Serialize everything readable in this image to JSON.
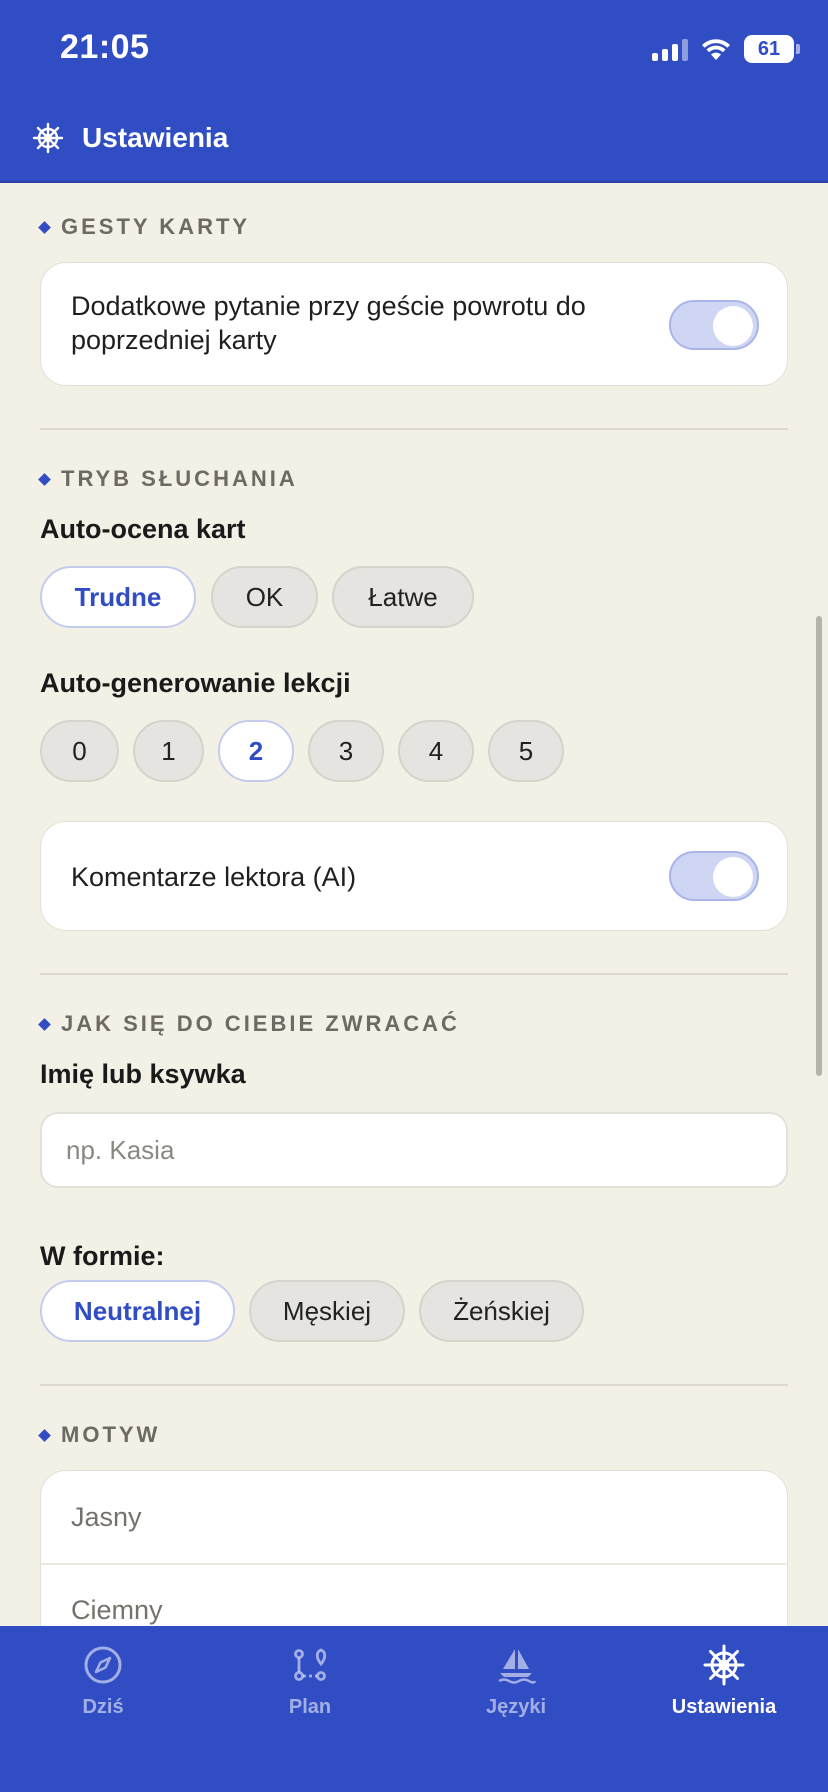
{
  "status_bar": {
    "time": "21:05",
    "battery": "61"
  },
  "header": {
    "title": "Ustawienia",
    "icon": "ship-wheel-icon"
  },
  "gestures": {
    "section_label": "GESTY KARTY",
    "confirm_back_text": "Dodatkowe pytanie przy geście powrotu do poprzedniej karty",
    "confirm_back_enabled": true
  },
  "listening": {
    "section_label": "TRYB SŁUCHANIA",
    "auto_rating_heading": "Auto-ocena kart",
    "auto_rating_options": [
      "Trudne",
      "OK",
      "Łatwe"
    ],
    "auto_rating_selected": "Trudne",
    "auto_lessons_heading": "Auto-generowanie lekcji",
    "auto_lessons_options": [
      "0",
      "1",
      "2",
      "3",
      "4",
      "5"
    ],
    "auto_lessons_selected": "2",
    "narrator_text": "Komentarze lektora (AI)",
    "narrator_enabled": true
  },
  "address": {
    "section_label": "JAK SIĘ DO CIEBIE ZWRACAĆ",
    "name_heading": "Imię lub ksywka",
    "name_placeholder": "np. Kasia",
    "name_value": "",
    "form_heading": "W formie:",
    "form_options": [
      "Neutralnej",
      "Męskiej",
      "Żeńskiej"
    ],
    "form_selected": "Neutralnej"
  },
  "theme": {
    "section_label": "MOTYW",
    "options": [
      "Jasny",
      "Ciemny"
    ]
  },
  "tabbar": {
    "tabs": [
      {
        "label": "Dziś",
        "icon": "compass-icon",
        "active": false
      },
      {
        "label": "Plan",
        "icon": "route-icon",
        "active": false
      },
      {
        "label": "Języki",
        "icon": "sailboat-icon",
        "active": false
      },
      {
        "label": "Ustawienia",
        "icon": "ship-wheel-icon",
        "active": true
      }
    ]
  },
  "colors": {
    "primary": "#314DC4",
    "background": "#F3F0E6",
    "toggle_on": "#CED6F3"
  }
}
